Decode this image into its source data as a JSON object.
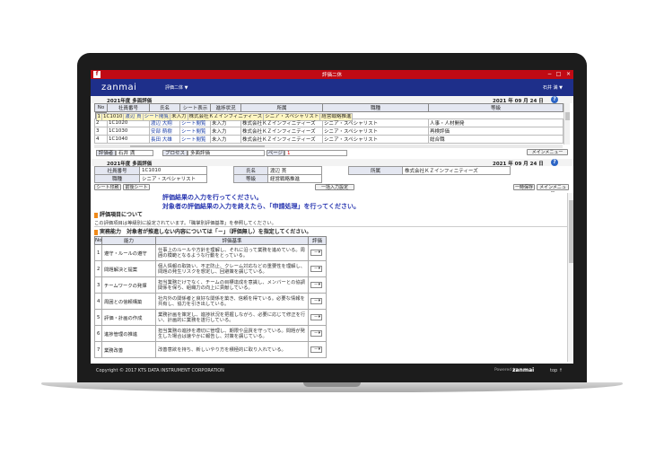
{
  "window": {
    "title": "評価二休"
  },
  "app": {
    "logo": "zanmai",
    "menu": "評価二体 ▼",
    "user": "石井 満 ▼"
  },
  "list_band": {
    "left": "2021年度 多面評価",
    "date": "2021 年 09 月 24 日"
  },
  "list": {
    "headers": [
      "No",
      "社員番号",
      "氏名",
      "シート表示",
      "進捗状況",
      "所属",
      "職種",
      "等級"
    ],
    "rows": [
      [
        "1",
        "1C1010",
        "渡辺 貫",
        "シート閲覧",
        "未入力",
        "株式会社ＫＺインフィニティーズ",
        "シニア・スペシャリスト",
        "経営戦略推進"
      ],
      [
        "2",
        "1C1020",
        "渡辺 大翔",
        "シート閲覧",
        "未入力",
        "株式会社ＫＺインフィニティーズ",
        "シニア・スペシャリスト",
        "人事・人材開発"
      ],
      [
        "3",
        "1C1030",
        "安部 萌樹",
        "シート閲覧",
        "未入力",
        "株式会社ＫＺインフィニティーズ",
        "シニア・スペシャリスト",
        "再検評価"
      ],
      [
        "4",
        "1C1040",
        "長田 大雄",
        "シート閲覧",
        "未入力",
        "株式会社ＫＺインフィニティーズ",
        "シニア・スペシャリスト",
        "総合職"
      ]
    ]
  },
  "filter": {
    "evaluator_label": "評価者",
    "evaluator_value": "石井 満",
    "process_label": "プロセス",
    "process_value": "多面評価",
    "page_label": "ページ",
    "page_value": "1",
    "main_menu": "メインメニュー"
  },
  "detail_band": {
    "left": "2021年度 多面評価",
    "date": "2021 年 09 月 24 日"
  },
  "info": {
    "emp_no_label": "社員番号",
    "emp_no": "1C1010",
    "name_label": "氏名",
    "name": "渡辺 貫",
    "dept_label": "所属",
    "dept": "株式会社ＫＺインフィニティーズ",
    "job_label": "職種",
    "job": "シニア・スペシャリスト",
    "grade_label": "等級",
    "grade": "経営戦略推進"
  },
  "toolbar": {
    "sheet_print": "シート印刷",
    "transfer_sheet": "前後シート",
    "bulk_input": "一括入力設定",
    "temp_save": "一時保存",
    "main_menu": "メインメニュー"
  },
  "messages": {
    "line1": "評価結果の入力を行ってください。",
    "line2": "対象者の評価結果の入力を終えたら、「申請処理」を行ってください。"
  },
  "section1": {
    "title": "評価項目について"
  },
  "note": "この評価項目は等級別に設定されています。「職掌別評価基準」を参照してください。",
  "section2": {
    "title": "実務能力　対象者が推進しない内容については「－」（評価無し）を指定してください。"
  },
  "eval": {
    "headers": [
      "No",
      "能力",
      "評価基準",
      "評価"
    ],
    "rows": [
      {
        "no": "1",
        "name": "遵守・ルールの遵守",
        "desc": "仕事上のルールや方針を理解し、それに沿って業務を進めている。周囲の模範となるような行動をとっている。",
        "value": "－"
      },
      {
        "no": "2",
        "name": "問題解決と提案",
        "desc": "個人情報の取扱い、不正防止、クレーム対応などの重要性を理解し、問題の発生リスクを想定し、回避策を講じている。",
        "value": "－"
      },
      {
        "no": "3",
        "name": "チームワークの発揮",
        "desc": "担当業務だけでなく、チームの目標達成を意識し、メンバーとの協調関係を保ち、組織力の向上に貢献している。",
        "value": "－"
      },
      {
        "no": "4",
        "name": "周囲との信頼構築",
        "desc": "社内外の関係者と良好な関係を築き、信頼を得ている。必要な情報を共有し、協力を引き出している。",
        "value": "－"
      },
      {
        "no": "5",
        "name": "評価・計画の作成",
        "desc": "業務計画を策定し、進捗状況を把握しながら、必要に応じて修正を行い、計画的に業務を遂行している。",
        "value": "－"
      },
      {
        "no": "6",
        "name": "進捗管理の推進",
        "desc": "担当業務の進捗を適切に管理し、期限や品質を守っている。問題が発生した場合は速やかに報告し、対策を講じている。",
        "value": "－"
      },
      {
        "no": "7",
        "name": "業務改善",
        "desc": "改善意欲を持ち、新しいやり方を積極的に取り入れている。",
        "value": "－"
      }
    ]
  },
  "footer": {
    "copyright": "Copyright © 2017 KTS DATA INSTRUMENT CORPORATION",
    "powered": "Powered by",
    "brand": "zanmai",
    "top": "top ↑"
  }
}
